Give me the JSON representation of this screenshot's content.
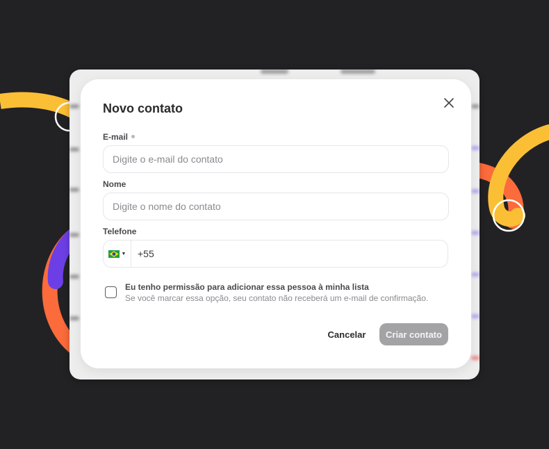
{
  "modal": {
    "title": "Novo contato",
    "email": {
      "label": "E-mail",
      "placeholder": "Digite o e-mail do contato",
      "value": ""
    },
    "name": {
      "label": "Nome",
      "placeholder": "Digite o nome do contato",
      "value": ""
    },
    "phone": {
      "label": "Telefone",
      "country": "BR",
      "flag_icon": "brazil-flag-icon",
      "prefix": "+55"
    },
    "permission": {
      "checked": false,
      "label": "Eu tenho permissão para adicionar essa pessoa à minha lista",
      "hint": "Se você marcar essa opção, seu contato não receberá um e-mail de confirmação."
    },
    "actions": {
      "cancel_label": "Cancelar",
      "create_label": "Criar contato",
      "create_enabled": false
    }
  },
  "colors": {
    "background": "#222224",
    "accent_yellow": "#fbbf36",
    "accent_orange": "#fb6b3b",
    "accent_purple": "#6c3fe6",
    "disabled_button": "#a3a3a6"
  }
}
